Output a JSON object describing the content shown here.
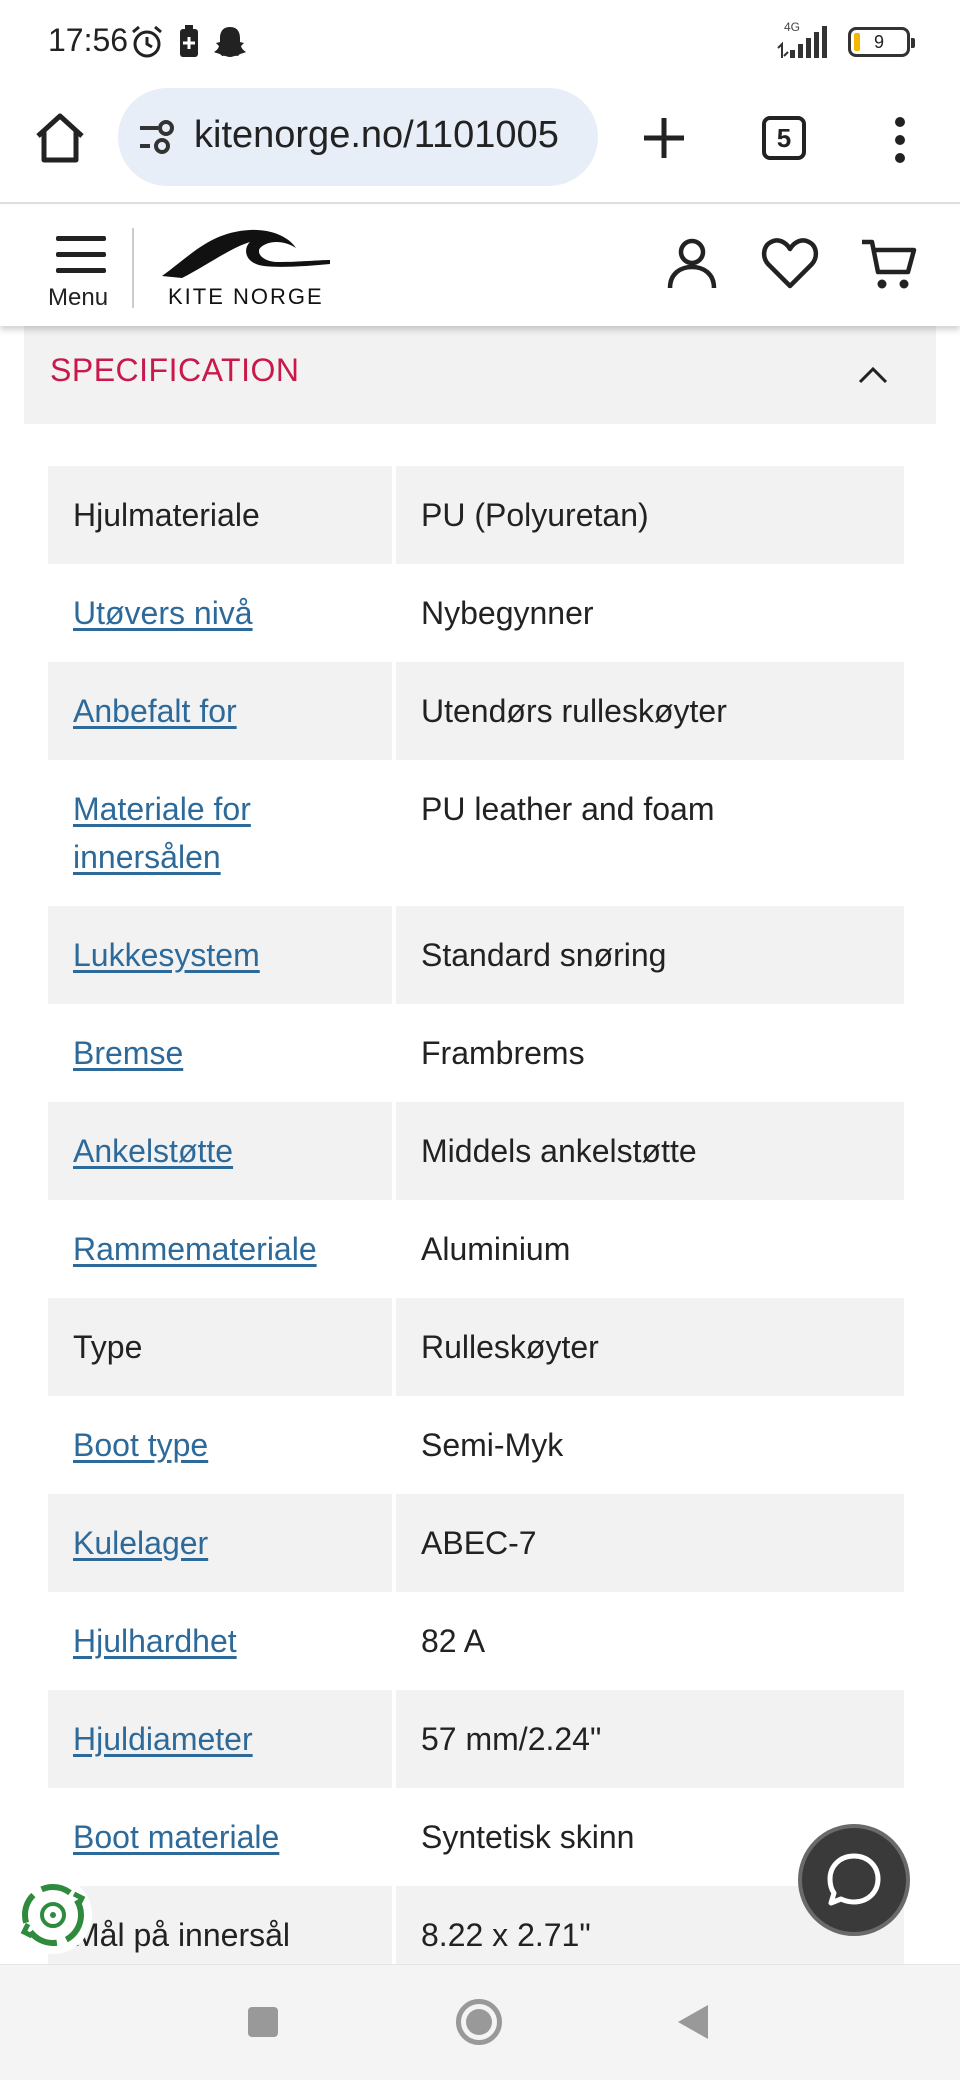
{
  "status_bar": {
    "time": "17:56",
    "network": "4G",
    "battery": "9",
    "icons": [
      "alarm-icon",
      "battery-saver-icon",
      "snapchat-icon"
    ]
  },
  "browser": {
    "url": "kitenorge.no/1101005",
    "tab_count": "5"
  },
  "site_header": {
    "menu_label": "Menu",
    "logo_text": "KITE NORGE"
  },
  "specification": {
    "title": "SPECIFICATION",
    "rows": [
      {
        "key": "Hjulmateriale",
        "value": "PU (Polyuretan)",
        "link": false
      },
      {
        "key": "Utøvers nivå",
        "value": "Nybegynner",
        "link": true
      },
      {
        "key": "Anbefalt for",
        "value": "Utendørs rulleskøyter",
        "link": true
      },
      {
        "key": "Materiale for innersålen",
        "value": "PU leather and foam",
        "link": true
      },
      {
        "key": "Lukkesystem",
        "value": "Standard snøring",
        "link": true
      },
      {
        "key": "Bremse",
        "value": "Frambrems",
        "link": true
      },
      {
        "key": "Ankelstøtte",
        "value": "Middels ankelstøtte",
        "link": true
      },
      {
        "key": "Rammemateriale",
        "value": "Aluminium",
        "link": true
      },
      {
        "key": "Type",
        "value": "Rulleskøyter",
        "link": false
      },
      {
        "key": "Boot type",
        "value": "Semi-Myk",
        "link": true
      },
      {
        "key": "Kulelager",
        "value": "ABEC-7",
        "link": true
      },
      {
        "key": "Hjulhardhet",
        "value": "82 A",
        "link": true
      },
      {
        "key": "Hjuldiameter",
        "value": "57 mm/2.24\"",
        "link": true
      },
      {
        "key": "Boot materiale",
        "value": "Syntetisk skinn",
        "link": true
      },
      {
        "key": "Mål på innersål",
        "value": "8.22 x 2.71\"",
        "link": false
      }
    ]
  },
  "colors": {
    "accent": "#c8194a",
    "link": "#2d6a9a",
    "row_shade": "#f2f2f2",
    "eco_green": "#2e8b3e"
  }
}
